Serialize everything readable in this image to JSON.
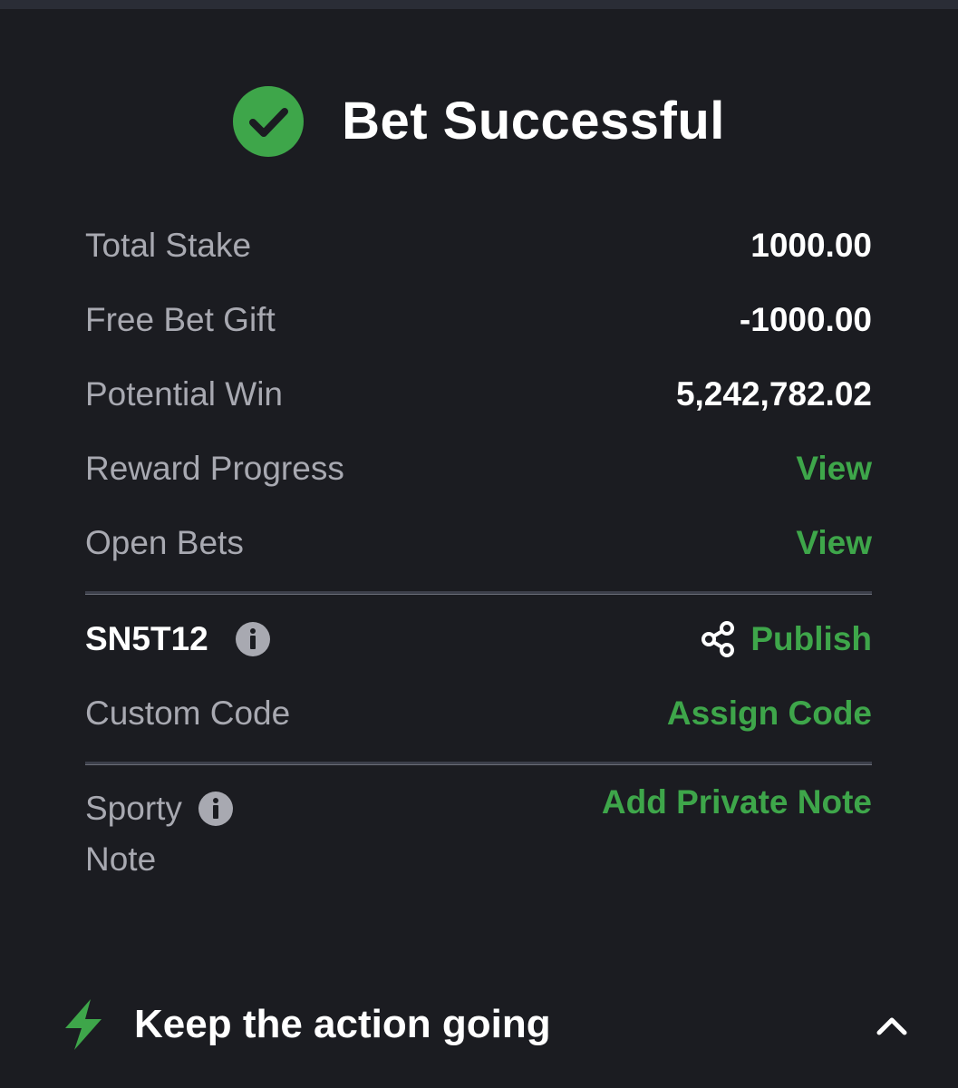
{
  "header": {
    "title": "Bet Successful",
    "icon": "check-circle-icon",
    "accent_color": "#3ea64a"
  },
  "summary": {
    "rows": [
      {
        "label": "Total Stake",
        "value": "1000.00"
      },
      {
        "label": "Free Bet Gift",
        "value": "-1000.00"
      },
      {
        "label": "Potential Win",
        "value": "5,242,782.02"
      }
    ],
    "links": [
      {
        "label": "Reward Progress",
        "action": "View"
      },
      {
        "label": "Open Bets",
        "action": "View"
      }
    ]
  },
  "booking": {
    "code": "SN5T12",
    "info_icon": "info-icon",
    "publish_icon": "share-icon",
    "publish_label": "Publish",
    "custom_code_label": "Custom Code",
    "assign_code_label": "Assign Code"
  },
  "note": {
    "label_line1": "Sporty",
    "label_line2": "Note",
    "info_icon": "info-icon",
    "add_note_label": "Add Private Note"
  },
  "footer": {
    "icon": "bolt-icon",
    "title": "Keep the action going",
    "toggle_icon": "chevron-up-icon"
  },
  "colors": {
    "background": "#1b1c21",
    "label": "#a8a9b1",
    "link": "#3ea64a",
    "value": "#ffffff"
  }
}
